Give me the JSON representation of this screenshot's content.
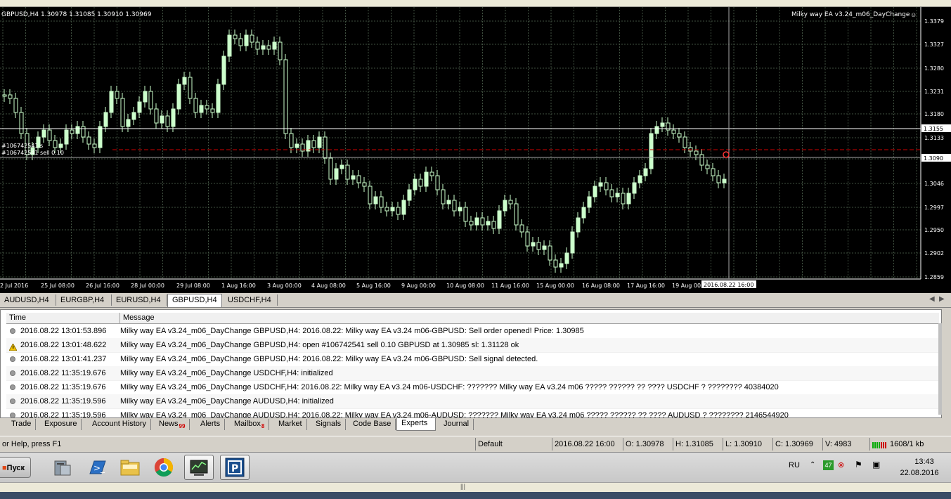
{
  "chart": {
    "header": "GBPUSD,H4  1.30978 1.31085 1.30910 1.30969",
    "ea_label": "Milky way EA v3.24_m06_DayChange",
    "order_label_1": "#106742541 s",
    "order_label_2": "#106742541 sell 0.10",
    "price_labels": [
      "1.3379",
      "1.3327",
      "1.3280",
      "1.3231",
      "1.3180",
      "1.3133",
      "1.3090",
      "1.3046",
      "1.2997",
      "1.2950",
      "1.2902",
      "1.2859"
    ],
    "current_price_label": "1.3155",
    "bid_price_label": "1.3090",
    "time_labels": [
      "2 Jul 2016",
      "25 Jul 08:00",
      "26 Jul 16:00",
      "28 Jul 00:00",
      "29 Jul 08:00",
      "1 Aug 16:00",
      "3 Aug 00:00",
      "4 Aug 08:00",
      "5 Aug 16:00",
      "9 Aug 00:00",
      "10 Aug 08:00",
      "11 Aug 16:00",
      "15 Aug 00:00",
      "16 Aug 08:00",
      "17 Aug 16:00",
      "19 Aug 00:00"
    ],
    "crosshair_time": "2016.08.22 16:00",
    "colors": {
      "background": "#000000",
      "candle": "#ccffcc",
      "grid": "#3f4f3f",
      "stop_line": "#cc0000"
    }
  },
  "symbol_tabs": [
    "AUDUSD,H4",
    "EURGBP,H4",
    "EURUSD,H4",
    "GBPUSD,H4",
    "USDCHF,H4"
  ],
  "active_symbol_tab": "GBPUSD,H4",
  "terminal": {
    "col_time": "Time",
    "col_message": "Message",
    "rows": [
      {
        "icon": "info-dot-icon",
        "time": "2016.08.22 13:01:53.896",
        "message": "Milky way EA v3.24_m06_DayChange GBPUSD,H4: 2016.08.22: Milky way EA v3.24 m06-GBPUSD:  Sell order opened! Price: 1.30985"
      },
      {
        "icon": "warning-icon",
        "time": "2016.08.22 13:01:48.622",
        "message": "Milky way EA v3.24_m06_DayChange GBPUSD,H4: open #106742541 sell 0.10 GBPUSD at 1.30985 sl: 1.31128 ok"
      },
      {
        "icon": "info-dot-icon",
        "time": "2016.08.22 13:01:41.237",
        "message": "Milky way EA v3.24_m06_DayChange GBPUSD,H4: 2016.08.22: Milky way EA v3.24 m06-GBPUSD:  Sell signal detected."
      },
      {
        "icon": "info-dot-icon",
        "time": "2016.08.22 11:35:19.676",
        "message": "Milky way EA v3.24_m06_DayChange USDCHF,H4: initialized"
      },
      {
        "icon": "info-dot-icon",
        "time": "2016.08.22 11:35:19.676",
        "message": "Milky way EA v3.24_m06_DayChange USDCHF,H4: 2016.08.22: Milky way EA v3.24 m06-USDCHF:  ??????? Milky way EA v3.24 m06 ????? ?????? ?? ???? USDCHF ? ???????? 40384020"
      },
      {
        "icon": "info-dot-icon",
        "time": "2016.08.22 11:35:19.596",
        "message": "Milky way EA v3.24_m06_DayChange AUDUSD,H4: initialized"
      },
      {
        "icon": "info-dot-icon",
        "time": "2016.08.22 11:35:19.596",
        "message": "Milky way EA v3.24_m06_DayChange AUDUSD,H4: 2016.08.22: Milky way EA v3.24 m06-AUDUSD:  ??????? Milky way EA v3.24 m06 ????? ?????? ?? ???? AUDUSD ? ???????? 2146544920"
      }
    ]
  },
  "bottom_tabs": [
    {
      "label": "Trade",
      "badge": ""
    },
    {
      "label": "Exposure",
      "badge": ""
    },
    {
      "label": "Account History",
      "badge": ""
    },
    {
      "label": "News",
      "badge": "99"
    },
    {
      "label": "Alerts",
      "badge": ""
    },
    {
      "label": "Mailbox",
      "badge": "8"
    },
    {
      "label": "Market",
      "badge": ""
    },
    {
      "label": "Signals",
      "badge": ""
    },
    {
      "label": "Code Base",
      "badge": ""
    },
    {
      "label": "Experts",
      "badge": ""
    },
    {
      "label": "Journal",
      "badge": ""
    }
  ],
  "active_bottom_tab": "Experts",
  "status": {
    "help": "or Help, press F1",
    "profile": "Default",
    "datetime": "2016.08.22 16:00",
    "open": "O: 1.30978",
    "high": "H: 1.31085",
    "low": "L: 1.30910",
    "close": "C: 1.30969",
    "volume": "V: 4983",
    "traffic": "1608/1 kb"
  },
  "taskbar": {
    "start_label": "Пуск",
    "language": "RU",
    "tray_badge": "47",
    "time": "13:43",
    "date": "22.08.2016"
  }
}
